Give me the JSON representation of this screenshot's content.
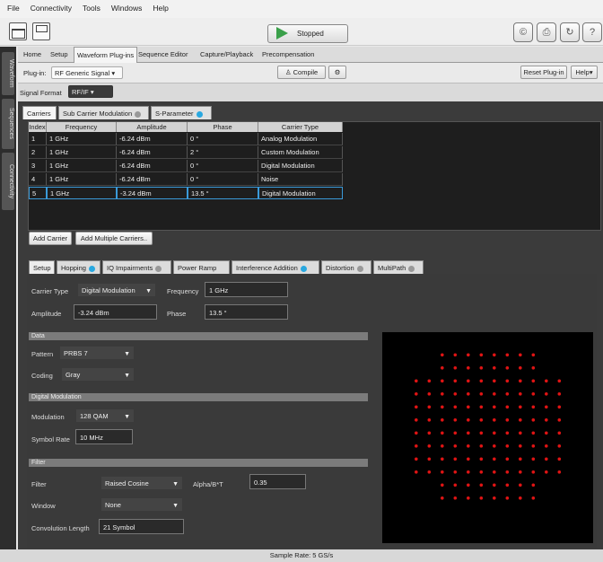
{
  "menu": [
    "File",
    "Connectivity",
    "Tools",
    "Windows",
    "Help"
  ],
  "toolbar": {
    "run_state": "Stopped",
    "right_icons": [
      "©",
      "⎙",
      "↻",
      "?"
    ]
  },
  "side_tabs": [
    "Waveform",
    "Sequences",
    "Connectivity"
  ],
  "nav": [
    "Home",
    "Setup",
    "Waveform Plug-ins",
    "Sequence Editor",
    "Capture/Playback",
    "Precompensation"
  ],
  "nav_active": "Waveform Plug-ins",
  "plugin": {
    "label": "Plug-in:",
    "value": "RF Generic Signal",
    "compile": "Compile",
    "reset": "Reset Plug-in",
    "help": "Help"
  },
  "signal_format": {
    "label": "Signal Format",
    "value": "RF/IF"
  },
  "carrier_tabs": [
    "Carriers",
    "Sub Carrier Modulation",
    "S-Parameter"
  ],
  "table": {
    "headers": [
      "Index",
      "Frequency",
      "Amplitude",
      "Phase",
      "Carrier Type"
    ],
    "rows": [
      [
        "1",
        "1 GHz",
        "-6.24 dBm",
        "0 °",
        "Analog Modulation"
      ],
      [
        "2",
        "1 GHz",
        "-6.24 dBm",
        "2 °",
        "Custom Modulation"
      ],
      [
        "3",
        "1 GHz",
        "-6.24 dBm",
        "0 °",
        "Digital Modulation"
      ],
      [
        "4",
        "1 GHz",
        "-6.24 dBm",
        "0 °",
        "Noise"
      ],
      [
        "5",
        "1 GHz",
        "-3.24 dBm",
        "13.5 °",
        "Digital Modulation"
      ]
    ],
    "selected_row": 5
  },
  "carrier_buttons": {
    "add": "Add Carrier",
    "add_multi": "Add Multiple Carriers.."
  },
  "sub_tabs": [
    "Setup",
    "Hopping",
    "IQ Impairments",
    "Power Ramp",
    "Interference Addition",
    "Distortion",
    "MultiPath"
  ],
  "setup": {
    "carrier_type_label": "Carrier Type",
    "carrier_type": "Digital Modulation",
    "frequency_label": "Frequency",
    "frequency": "1 GHz",
    "amplitude_label": "Amplitude",
    "amplitude": "-3.24 dBm",
    "phase_label": "Phase",
    "phase": "13.5 °",
    "data_header": "Data",
    "pattern_label": "Pattern",
    "pattern": "PRBS 7",
    "coding_label": "Coding",
    "coding": "Gray",
    "dm_header": "Digital Modulation",
    "modulation_label": "Modulation",
    "modulation": "128 QAM",
    "symbol_rate_label": "Symbol Rate",
    "symbol_rate": "10 MHz",
    "filter_header": "Filter",
    "filter_label": "Filter",
    "filter": "Raised Cosine",
    "alpha_label": "Alpha/B*T",
    "alpha": "0.35",
    "window_label": "Window",
    "window": "None",
    "conv_label": "Convolution Length",
    "conv": "21 Symbol"
  },
  "constellation": {
    "order": 128,
    "dot_color": "#e01414"
  },
  "status": "Sample Rate: 5 GS/s"
}
